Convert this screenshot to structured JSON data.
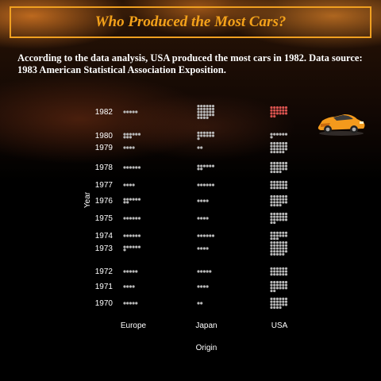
{
  "title": "Who Produced the Most Cars?",
  "subtitle": "According to the data analysis, USA produced the most cars in 1982. Data source: 1983 American Statistical Association Exposition.",
  "colors": {
    "title": "#f4a21a",
    "dot": "#b8b8b8",
    "highlight": "#d9534f",
    "text": "#ffffff"
  },
  "chart_data": {
    "type": "scatter",
    "xlabel": "Origin",
    "ylabel": "Year",
    "categories": [
      "Europe",
      "Japan",
      "USA"
    ],
    "years": [
      1970,
      1971,
      1972,
      1973,
      1974,
      1975,
      1976,
      1977,
      1978,
      1979,
      1980,
      1982
    ],
    "counts": {
      "Europe": [
        5,
        4,
        5,
        7,
        6,
        6,
        8,
        4,
        6,
        4,
        9,
        5
      ],
      "Japan": [
        2,
        4,
        5,
        4,
        6,
        4,
        4,
        6,
        8,
        2,
        13,
        28
      ],
      "USA": [
        22,
        20,
        18,
        29,
        15,
        20,
        22,
        18,
        22,
        23,
        7,
        20
      ]
    },
    "highlight": {
      "origin": "USA",
      "year": 1982
    }
  },
  "car_icon": "sports-car-icon"
}
